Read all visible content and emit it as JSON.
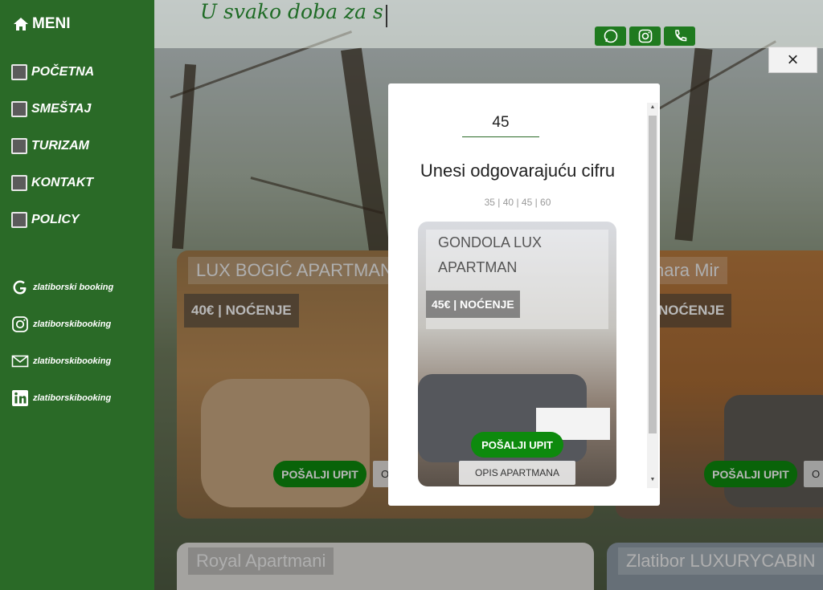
{
  "sidebar": {
    "menu_label": "MENI",
    "nav": [
      {
        "label": "POČETNA",
        "icon": "building-icon"
      },
      {
        "label": "SMEŠTAJ",
        "icon": "bed-icon"
      },
      {
        "label": "TURIZAM",
        "icon": "info-person-icon"
      },
      {
        "label": "KONTAKT",
        "icon": "contact-icon"
      },
      {
        "label": "POLICY",
        "icon": "policy-icon"
      }
    ],
    "social": [
      {
        "label": "zlatiborski booking",
        "icon": "google-icon"
      },
      {
        "label": "zlatiborskibooking",
        "icon": "instagram-icon"
      },
      {
        "label": "zlatiborskibooking",
        "icon": "mail-icon"
      },
      {
        "label": "zlatiborskibooking",
        "icon": "linkedin-icon"
      }
    ]
  },
  "header": {
    "slogan": "U svako doba za s",
    "buttons": [
      "whatsapp-icon",
      "instagram-icon",
      "phone-icon"
    ]
  },
  "cards": [
    {
      "title": "LUX BOGIĆ APARTMAN",
      "price": "40€ | NOĆENJE",
      "send": "POŠALJI UPIT",
      "desc": "O"
    },
    {
      "title": "nara Mir",
      "price": "NOĆENJE",
      "send": "POŠALJI UPIT",
      "desc": "O"
    },
    {
      "title": "Royal Apartmani"
    },
    {
      "title": "Zlatibor LUXURYCABIN"
    }
  ],
  "modal": {
    "close_label": "×",
    "captcha_value": "45",
    "captcha_title": "Unesi odgovarajuću cifru",
    "captcha_options": "35 | 40 | 45 | 60",
    "card": {
      "title": "GONDOLA LUX APARTMAN",
      "price": "45€ | NOĆENJE",
      "send": "POŠALJI UPIT",
      "desc": "OPIS APARTMANA"
    }
  },
  "colors": {
    "sidebar": "#2a6a27",
    "accent": "#0d8a0d",
    "slogan": "#1e6b25"
  }
}
